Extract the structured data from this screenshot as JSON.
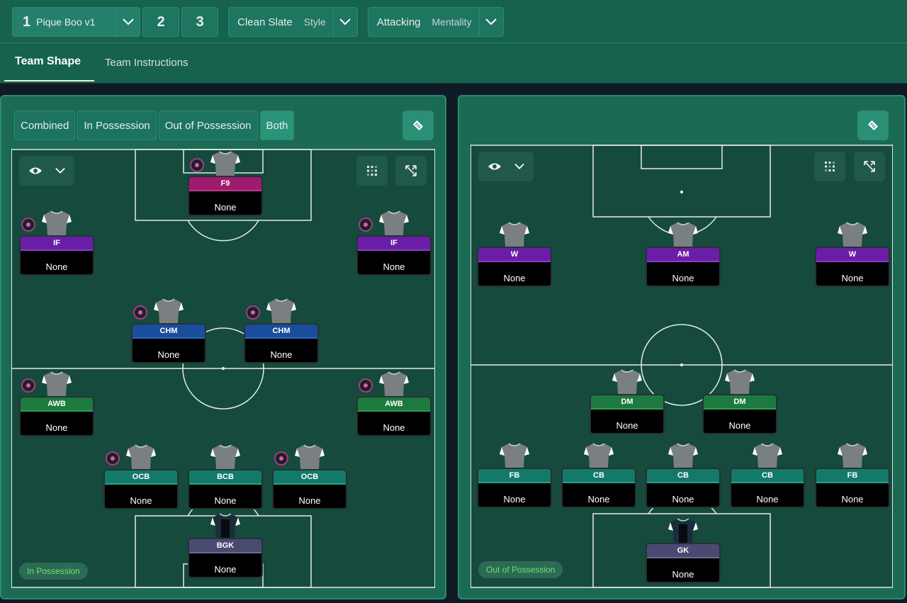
{
  "tactics": {
    "slot1_number": "1",
    "slot1_name": "Pique Boo v1",
    "slot2_number": "2",
    "slot3_number": "3",
    "style_value": "Clean Slate",
    "style_label": "Style",
    "mentality_value": "Attacking",
    "mentality_label": "Mentality"
  },
  "tabs": [
    {
      "label": "Team Shape",
      "active": true
    },
    {
      "label": "Team Instructions",
      "active": false
    }
  ],
  "left_panel": {
    "segments": [
      {
        "label": "Combined",
        "active": false
      },
      {
        "label": "In Possession",
        "active": false
      },
      {
        "label": "Out of Possession",
        "active": false
      },
      {
        "label": "Both",
        "active": true
      }
    ],
    "phase_label": "In Possession",
    "players": [
      {
        "role": "F9",
        "name": "None",
        "color": "#9c1c6d",
        "instruction": true
      },
      {
        "role": "IF",
        "name": "None",
        "color": "#6a1ea6",
        "instruction": true
      },
      {
        "role": "IF",
        "name": "None",
        "color": "#6a1ea6",
        "instruction": true
      },
      {
        "role": "CHM",
        "name": "None",
        "color": "#1a4d9c",
        "instruction": true
      },
      {
        "role": "CHM",
        "name": "None",
        "color": "#1a4d9c",
        "instruction": true
      },
      {
        "role": "AWB",
        "name": "None",
        "color": "#1c7a3e",
        "instruction": true
      },
      {
        "role": "AWB",
        "name": "None",
        "color": "#1c7a3e",
        "instruction": true
      },
      {
        "role": "OCB",
        "name": "None",
        "color": "#137a6a",
        "instruction": true
      },
      {
        "role": "BCB",
        "name": "None",
        "color": "#137a6a",
        "instruction": false
      },
      {
        "role": "OCB",
        "name": "None",
        "color": "#137a6a",
        "instruction": true
      },
      {
        "role": "BGK",
        "name": "None",
        "color": "#4a4a70",
        "instruction": false
      }
    ]
  },
  "right_panel": {
    "phase_label": "Out of Possession",
    "players": [
      {
        "role": "W",
        "name": "None",
        "color": "#6a1ea6"
      },
      {
        "role": "AM",
        "name": "None",
        "color": "#6a1ea6"
      },
      {
        "role": "W",
        "name": "None",
        "color": "#6a1ea6"
      },
      {
        "role": "DM",
        "name": "None",
        "color": "#1c7a3e"
      },
      {
        "role": "DM",
        "name": "None",
        "color": "#1c7a3e"
      },
      {
        "role": "FB",
        "name": "None",
        "color": "#137a6a"
      },
      {
        "role": "CB",
        "name": "None",
        "color": "#137a6a"
      },
      {
        "role": "CB",
        "name": "None",
        "color": "#137a6a"
      },
      {
        "role": "CB",
        "name": "None",
        "color": "#137a6a"
      },
      {
        "role": "FB",
        "name": "None",
        "color": "#137a6a"
      },
      {
        "role": "GK",
        "name": "None",
        "color": "#4a4a70"
      }
    ]
  },
  "icons": {
    "dropdown": "chevron-down-icon",
    "view": "eye-icon",
    "grid": "grid-icon",
    "expand": "expand-icon",
    "swap": "tactic-swap-icon",
    "shirt": "shirt-icon"
  }
}
